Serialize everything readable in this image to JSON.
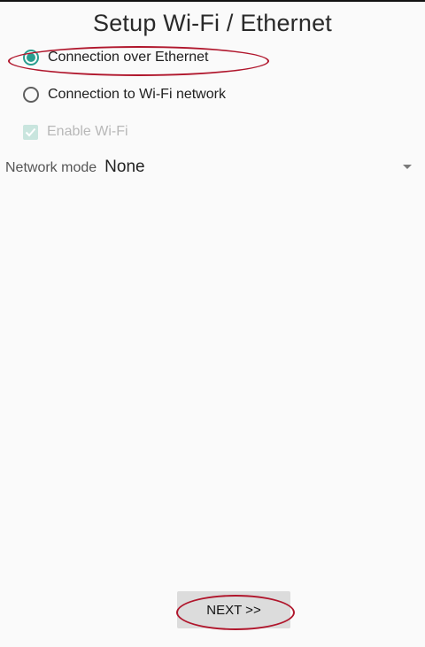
{
  "header": {
    "title": "Setup Wi-Fi / Ethernet"
  },
  "connection": {
    "options": [
      {
        "label": "Connection over Ethernet",
        "selected": true
      },
      {
        "label": "Connection to Wi-Fi network",
        "selected": false
      }
    ]
  },
  "wifi": {
    "enable_label": "Enable Wi-Fi",
    "checked": true,
    "disabled": true
  },
  "network_mode": {
    "label": "Network mode",
    "value": "None"
  },
  "footer": {
    "next_label": "NEXT >>"
  },
  "colors": {
    "accent": "#2a9d8f",
    "annotation": "#b0162c",
    "button": "#dcdcdc"
  }
}
